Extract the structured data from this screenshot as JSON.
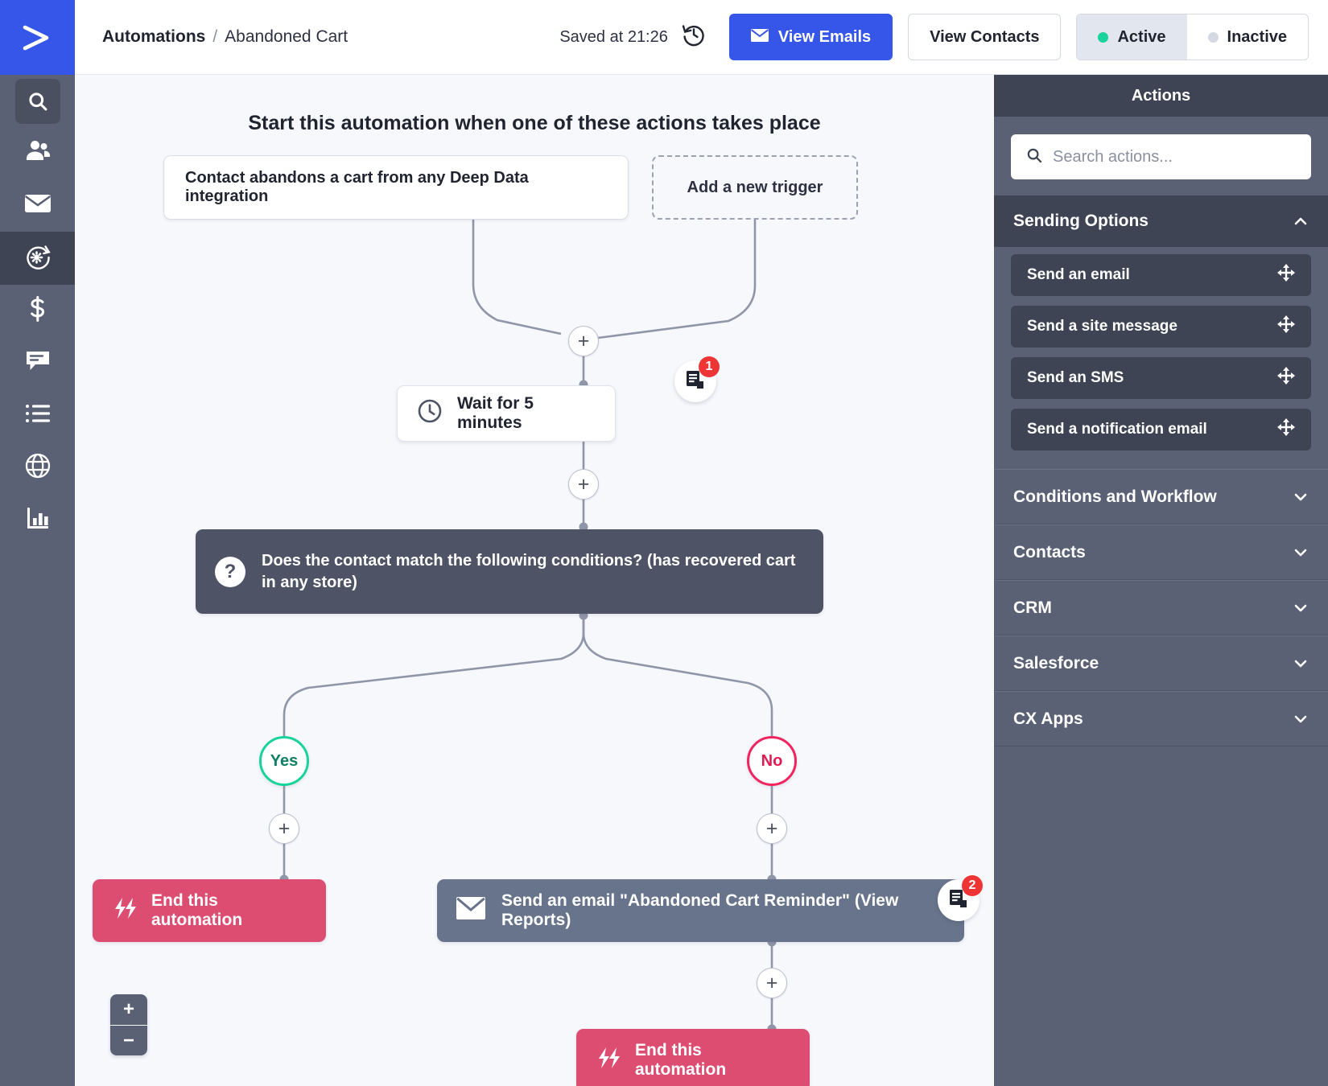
{
  "brand": {
    "logo_icon": "activecampaign-logo-icon",
    "accent": "#3556e8"
  },
  "rail": {
    "items": [
      {
        "icon": "search-icon",
        "name": "search",
        "active": false,
        "boxed": true
      },
      {
        "icon": "contacts-icon",
        "name": "contacts",
        "active": false,
        "boxed": false
      },
      {
        "icon": "envelope-icon",
        "name": "campaigns",
        "active": false,
        "boxed": false
      },
      {
        "icon": "automations-gear-icon",
        "name": "automations",
        "active": true,
        "boxed": false
      },
      {
        "icon": "dollar-icon",
        "name": "deals",
        "active": false,
        "boxed": false
      },
      {
        "icon": "chat-icon",
        "name": "conversations",
        "active": false,
        "boxed": false
      },
      {
        "icon": "list-icon",
        "name": "lists",
        "active": false,
        "boxed": false
      },
      {
        "icon": "globe-icon",
        "name": "website",
        "active": false,
        "boxed": false
      },
      {
        "icon": "bar-chart-icon",
        "name": "reports",
        "active": false,
        "boxed": false
      }
    ]
  },
  "topbar": {
    "breadcrumb_root": "Automations",
    "breadcrumb_sep": "/",
    "breadcrumb_current": "Abandoned Cart",
    "saved_text": "Saved at 21:26",
    "history_icon": "history-clock-icon",
    "view_emails_label": "View Emails",
    "view_emails_icon": "envelope-icon",
    "view_contacts_label": "View Contacts",
    "status": {
      "active_label": "Active",
      "active_dot_color": "#19d39d",
      "inactive_label": "Inactive",
      "inactive_dot_color": "#d5d9e3",
      "selected": "Active"
    }
  },
  "canvas": {
    "title": "Start this automation when one of these actions takes place",
    "triggers": [
      {
        "label": "Contact abandons a cart from any Deep Data integration",
        "style": "solid"
      },
      {
        "label": "Add a new trigger",
        "style": "dashed"
      }
    ],
    "plus_label": "+",
    "nodes": {
      "wait": {
        "label": "Wait for 5 minutes",
        "icon": "clock-icon",
        "badge_count": "1",
        "badge_icon": "report-icon"
      },
      "condition": {
        "label": "Does the contact match the following conditions? (has recovered cart in any store)",
        "icon": "question-mark-icon"
      },
      "yes_branch": {
        "label": "Yes",
        "color": "#19d39d"
      },
      "no_branch": {
        "label": "No",
        "color": "#f2245f"
      },
      "end_left": {
        "label": "End this automation",
        "icon": "end-automation-icon"
      },
      "send_email": {
        "label": "Send an email \"Abandoned Cart Reminder\" (View Reports)",
        "icon": "envelope-icon",
        "badge_count": "2",
        "badge_icon": "report-icon"
      },
      "end_right": {
        "label": "End this automation",
        "icon": "end-automation-icon"
      }
    },
    "zoom_in_label": "+",
    "zoom_out_label": "−"
  },
  "actions_panel": {
    "header": "Actions",
    "search_placeholder": "Search actions...",
    "search_value": "",
    "search_icon": "search-icon",
    "groups": [
      {
        "label": "Sending Options",
        "expanded": true,
        "chevron": "chevron-up-icon",
        "items": [
          {
            "label": "Send an email",
            "handle": "move-handle-icon"
          },
          {
            "label": "Send a site message",
            "handle": "move-handle-icon"
          },
          {
            "label": "Send an SMS",
            "handle": "move-handle-icon"
          },
          {
            "label": "Send a notification email",
            "handle": "move-handle-icon"
          }
        ]
      },
      {
        "label": "Conditions and Workflow",
        "expanded": false,
        "chevron": "chevron-down-icon",
        "items": []
      },
      {
        "label": "Contacts",
        "expanded": false,
        "chevron": "chevron-down-icon",
        "items": []
      },
      {
        "label": "CRM",
        "expanded": false,
        "chevron": "chevron-down-icon",
        "items": []
      },
      {
        "label": "Salesforce",
        "expanded": false,
        "chevron": "chevron-down-icon",
        "items": []
      },
      {
        "label": "CX Apps",
        "expanded": false,
        "chevron": "chevron-down-icon",
        "items": []
      }
    ]
  }
}
